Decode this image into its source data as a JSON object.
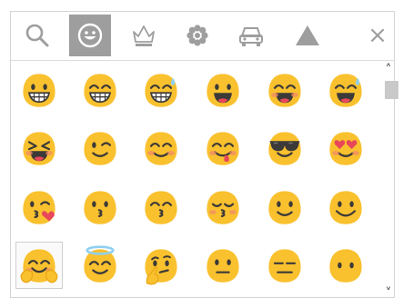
{
  "tabs": [
    {
      "name": "search-tab",
      "icon": "search-icon",
      "active": false
    },
    {
      "name": "tab-people",
      "icon": "smiley-icon",
      "active": true
    },
    {
      "name": "tab-objects",
      "icon": "crown-icon",
      "active": false
    },
    {
      "name": "tab-nature",
      "icon": "flower-icon",
      "active": false
    },
    {
      "name": "tab-places",
      "icon": "car-icon",
      "active": false
    },
    {
      "name": "tab-symbols",
      "icon": "triangle-icon",
      "active": false
    }
  ],
  "close_label": "×",
  "scroll_up_label": "˄",
  "scroll_down_label": "˅",
  "colors": {
    "face": "#f9c12e",
    "face_shade": "#e9a817",
    "feature": "#3c3a38",
    "tongue": "#e8475a",
    "blush": "#f28a6a",
    "heart": "#e8475a",
    "halo": "#8fd0f2",
    "tab_icon": "#9e9e9e",
    "active_tab_bg": "#9e9e9e"
  },
  "emojis": [
    [
      "grinning-face",
      "grinning-face-smiling-eyes",
      "grinning-face-sweat",
      "smiling-face-open-mouth",
      "smiling-face-open-mouth-blush",
      "smiling-face-open-mouth-sweat"
    ],
    [
      "laughing-squinting-face",
      "winking-face",
      "smiling-face-smiling-eyes",
      "face-savoring-food",
      "smiling-face-sunglasses",
      "smiling-face-heart-eyes"
    ],
    [
      "face-blowing-kiss",
      "kissing-face",
      "kissing-face-smiling-eyes",
      "kissing-face-closed-eyes",
      "slightly-smiling-face",
      "smiling-face"
    ],
    [
      "hugging-face",
      "smiling-face-halo",
      "thinking-face",
      "neutral-face",
      "expressionless-face",
      "face-without-mouth"
    ]
  ],
  "selected_emoji": "hugging-face"
}
